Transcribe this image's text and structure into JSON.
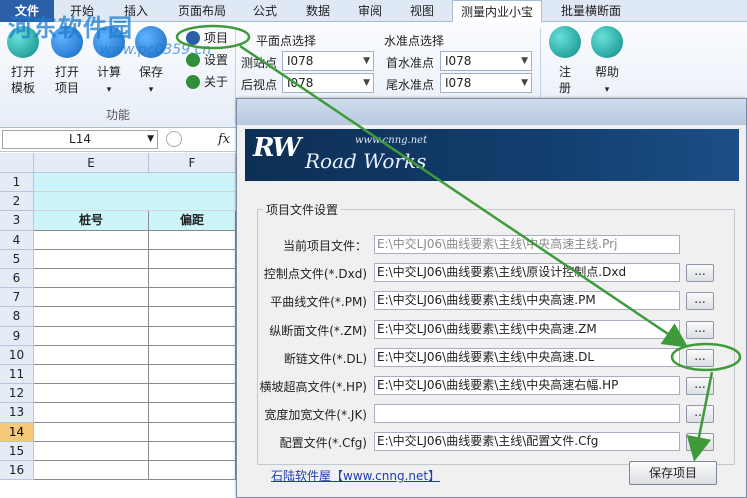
{
  "tabs": [
    {
      "label": "文件"
    },
    {
      "label": "开始"
    },
    {
      "label": "插入"
    },
    {
      "label": "页面布局"
    },
    {
      "label": "公式"
    },
    {
      "label": "数据"
    },
    {
      "label": "审阅"
    },
    {
      "label": "视图"
    },
    {
      "label": "测量内业小宝"
    },
    {
      "label": "批量横断面"
    }
  ],
  "watermark": {
    "text": "河东软件园",
    "sub": "www.pc0359.cn"
  },
  "ribbon": {
    "open_template": "打开\n模板",
    "open_project": "打开\n项目",
    "compute": "计算",
    "save": "保存",
    "project": "项目",
    "settings": "设置",
    "about": "关于",
    "group_function": "功能",
    "plane_point_select": "平面点选择",
    "station_label": "测站点",
    "station_value": "I078",
    "backsight_label": "后视点",
    "backsight_value": "I078",
    "level_point_select": "水准点选择",
    "first_level_label": "首水准点",
    "first_level_value": "I078",
    "last_level_label": "尾水准点",
    "last_level_value": "I078",
    "register": "注\n册",
    "help": "帮助"
  },
  "formula_bar": {
    "namebox": "L14",
    "fx": "fx"
  },
  "sheet": {
    "columns": [
      "E",
      "F"
    ],
    "rows": [
      "1",
      "2",
      "3",
      "4",
      "5",
      "6",
      "7",
      "8",
      "9",
      "10",
      "11",
      "12",
      "13",
      "14",
      "15",
      "16"
    ],
    "header_e": "桩号",
    "header_f": "偏距",
    "selected_row": "14"
  },
  "dialog": {
    "logo_mark": "RW",
    "logo_site": "www.cnng.net",
    "logo_brand": "Road Works",
    "group_title": "项目文件设置",
    "fields": [
      {
        "label": "当前项目文件：",
        "value": "E:\\中交LJ06\\曲线要素\\主线\\中央高速主线.Prj"
      },
      {
        "label": "控制点文件(*.Dxd)",
        "value": "E:\\中交LJ06\\曲线要素\\主线\\原设计控制点.Dxd"
      },
      {
        "label": "平曲线文件(*.PM)",
        "value": "E:\\中交LJ06\\曲线要素\\主线\\中央高速.PM"
      },
      {
        "label": "纵断面文件(*.ZM)",
        "value": "E:\\中交LJ06\\曲线要素\\主线\\中央高速.ZM"
      },
      {
        "label": "断链文件(*.DL)",
        "value": "E:\\中交LJ06\\曲线要素\\主线\\中央高速.DL"
      },
      {
        "label": "横坡超高文件(*.HP)",
        "value": "E:\\中交LJ06\\曲线要素\\主线\\中央高速右幅.HP"
      },
      {
        "label": "宽度加宽文件(*.JK)",
        "value": ""
      },
      {
        "label": "配置文件(*.Cfg)",
        "value": "E:\\中交LJ06\\曲线要素\\主线\\配置文件.Cfg"
      }
    ],
    "browse_label": "...",
    "link_text": "石陆软件屋【www.cnng.net】",
    "save_button": "保存项目"
  },
  "colors": {
    "accent": "#2a5fa8",
    "highlight_row": "#f5c87a",
    "cyan_fill": "#ccf5fb",
    "annotation_green": "#3f9a3a"
  }
}
